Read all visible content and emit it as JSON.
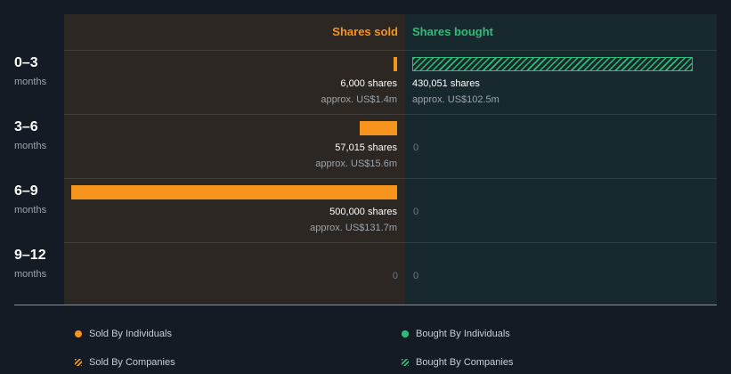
{
  "chart_data": {
    "type": "bar",
    "headers": {
      "sold": "Shares sold",
      "bought": "Shares bought"
    },
    "rows": [
      {
        "period": "0–3",
        "unit": "months",
        "sold_shares": 6000,
        "sold_label": "6,000 shares",
        "sold_value": "approx. US$1.4m",
        "bought_shares": 430051,
        "bought_label": "430,051 shares",
        "bought_value": "approx. US$102.5m"
      },
      {
        "period": "3–6",
        "unit": "months",
        "sold_shares": 57015,
        "sold_label": "57,015 shares",
        "sold_value": "approx. US$15.6m",
        "bought_shares": 0,
        "bought_zero": "0"
      },
      {
        "period": "6–9",
        "unit": "months",
        "sold_shares": 500000,
        "sold_label": "500,000 shares",
        "sold_value": "approx. US$131.7m",
        "bought_shares": 0,
        "bought_zero": "0"
      },
      {
        "period": "9–12",
        "unit": "months",
        "sold_shares": 0,
        "sold_zero": "0",
        "bought_shares": 0,
        "bought_zero": "0"
      }
    ],
    "max_shares": 500000,
    "legend": [
      {
        "label": "Sold By Individuals",
        "color": "#f7941d",
        "style": "dot"
      },
      {
        "label": "Bought By Individuals",
        "color": "#2ebd79",
        "style": "dot"
      },
      {
        "label": "Sold By Companies",
        "color": "#f7941d",
        "style": "hatch"
      },
      {
        "label": "Bought By Companies",
        "color": "#2ebd79",
        "style": "hatch"
      }
    ]
  }
}
